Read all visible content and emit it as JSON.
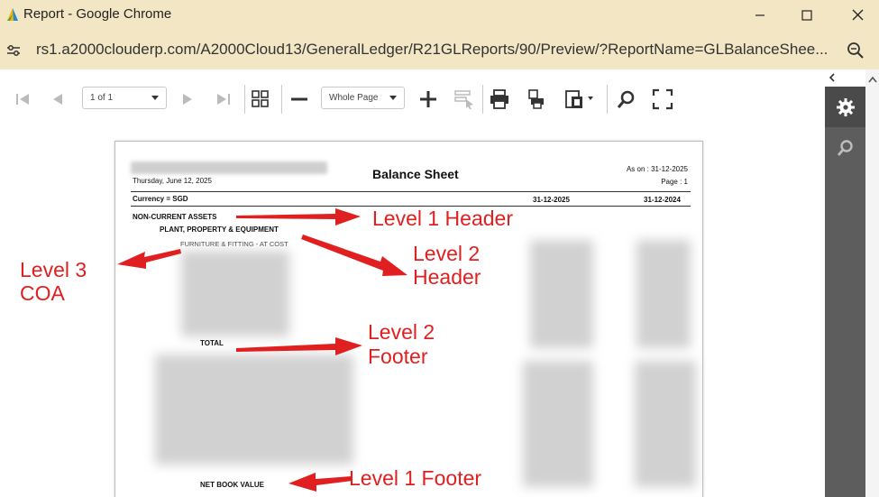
{
  "window": {
    "title": "Report - Google Chrome",
    "url": "rs1.a2000clouderp.com/A2000Cloud13/GeneralLedger/R21GLReports/90/Preview/?ReportName=GLBalanceShee..."
  },
  "toolbar": {
    "page_select": "1 of 1",
    "zoom_select": "Whole Page"
  },
  "report": {
    "date": "Thursday, June 12, 2025",
    "title": "Balance Sheet",
    "as_on": "As on : 31-12-2025",
    "page": "Page : 1",
    "currency": "Currency = SGD",
    "col1": "31-12-2025",
    "col2": "31-12-2024",
    "level1_header": "NON-CURRENT ASSETS",
    "level2_header": "PLANT, PROPERTY & EQUIPMENT",
    "level3_coa": "FURNITURE & FITTING - AT COST",
    "total": "TOTAL",
    "net_book_value": "NET BOOK VALUE"
  },
  "annotations": {
    "level1_header": "Level 1 Header",
    "level2_header_1": "Level 2",
    "level2_header_2": "Header",
    "level3_coa_1": "Level 3",
    "level3_coa_2": "COA",
    "level2_footer_1": "Level 2",
    "level2_footer_2": "Footer",
    "level1_footer": "Level 1 Footer"
  },
  "colors": {
    "title_bar": "#f2e6c5",
    "sidebar": "#5d5d5d",
    "annotation": "#e02020"
  },
  "icons": {
    "app": "report-app-icon",
    "site_info": "site-info-icon",
    "zoom": "zoom-icon",
    "sidebar_settings": "gear-icon",
    "sidebar_search": "search-icon"
  }
}
